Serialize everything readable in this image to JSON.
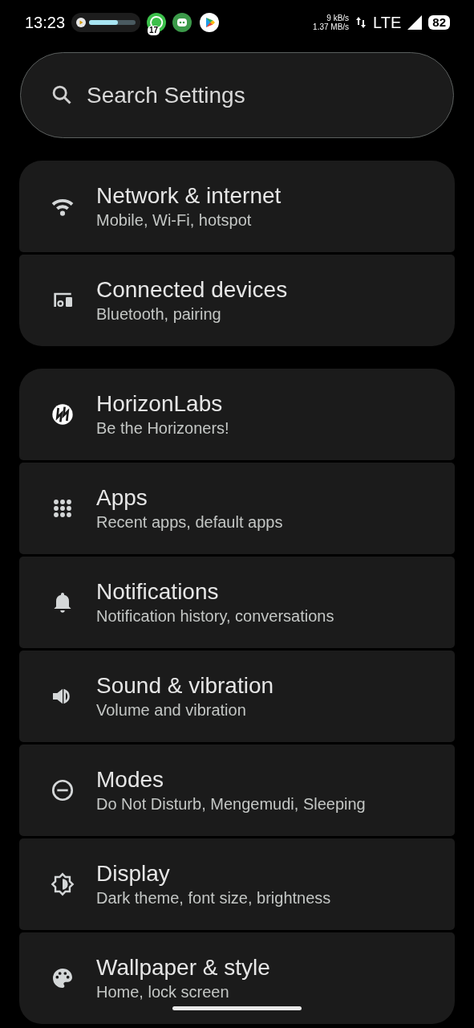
{
  "status_bar": {
    "time": "13:23",
    "media": {
      "level": 0.62
    },
    "notification_badge": "17",
    "speed_up": "9 kB/s",
    "speed_down": "1.37 MB/s",
    "network": "LTE",
    "battery": "82"
  },
  "search": {
    "placeholder": "Search Settings"
  },
  "groups": [
    {
      "items": [
        {
          "title": "Network & internet",
          "subtitle": "Mobile, Wi-Fi, hotspot"
        },
        {
          "title": "Connected devices",
          "subtitle": "Bluetooth, pairing"
        }
      ]
    },
    {
      "items": [
        {
          "title": "HorizonLabs",
          "subtitle": "Be the Horizoners!"
        },
        {
          "title": "Apps",
          "subtitle": "Recent apps, default apps"
        },
        {
          "title": "Notifications",
          "subtitle": "Notification history, conversations"
        },
        {
          "title": "Sound & vibration",
          "subtitle": "Volume and vibration"
        },
        {
          "title": "Modes",
          "subtitle": "Do Not Disturb, Mengemudi, Sleeping"
        },
        {
          "title": "Display",
          "subtitle": "Dark theme, font size, brightness"
        },
        {
          "title": "Wallpaper & style",
          "subtitle": "Home, lock screen"
        }
      ]
    }
  ]
}
